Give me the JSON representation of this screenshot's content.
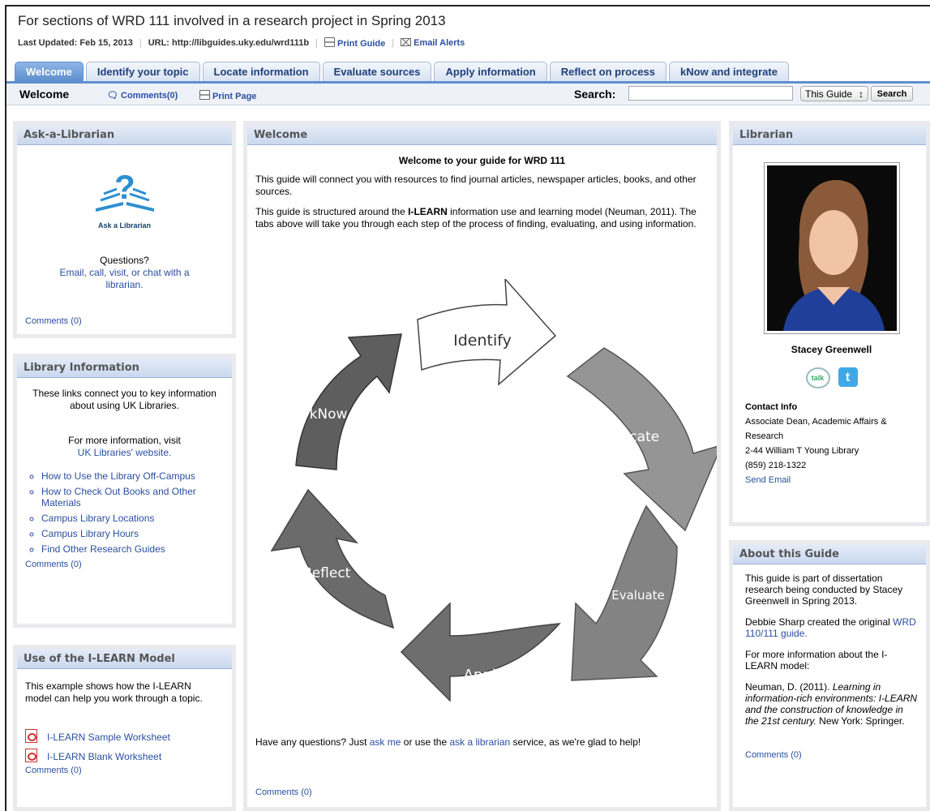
{
  "page": {
    "title": "For sections of WRD 111 involved in a research project in Spring 2013",
    "last_updated": "Last Updated: Feb 15, 2013",
    "url_label": "URL: http://libguides.uky.edu/wrd111b",
    "print_guide": "Print Guide",
    "email_alerts": "Email Alerts"
  },
  "tabs": [
    {
      "label": "Welcome",
      "active": true
    },
    {
      "label": "Identify your topic"
    },
    {
      "label": "Locate information"
    },
    {
      "label": "Evaluate sources"
    },
    {
      "label": "Apply information"
    },
    {
      "label": "Reflect on process"
    },
    {
      "label": "kNow and integrate"
    }
  ],
  "subbar": {
    "page_name": "Welcome",
    "comments": "Comments(0)",
    "print_page": "Print Page",
    "search_label": "Search:",
    "search_value": "",
    "scope": "This Guide",
    "search_button": "Search"
  },
  "ask": {
    "title": "Ask-a-Librarian",
    "logo_text": "Ask a Librarian",
    "questions": "Questions?",
    "link": "Email, call, visit, or chat with a librarian.",
    "comments": "Comments (0)"
  },
  "libinfo": {
    "title": "Library Information",
    "intro": "These links connect you to key information about using UK Libraries.",
    "more": "For more information, visit",
    "more_link": "UK Libraries' website.",
    "links": [
      "How to Use the Library Off-Campus",
      "How to Check Out Books and Other Materials",
      "Campus Library Locations",
      "Campus Library Hours",
      "Find Other Research Guides"
    ],
    "comments": "Comments (0)"
  },
  "model": {
    "title": "Use of the I-LEARN Model",
    "text": "This example shows how the I-LEARN model can help you work through a topic.",
    "files": [
      "I-LEARN Sample Worksheet",
      "I-LEARN Blank Worksheet"
    ],
    "comments": "Comments (0)"
  },
  "welcome": {
    "title": "Welcome",
    "heading": "Welcome to your guide for WRD 111",
    "p1": "This guide will connect you with resources to find journal articles, newspaper articles, books, and other sources.",
    "p2_a": "This guide is structured around the ",
    "p2_b": "I-LEARN",
    "p2_c": " information use and learning model (Neuman, 2011).  The tabs above will take you through each step of the process of finding, evaluating, and using information.",
    "cycle": [
      "Identify",
      "Locate",
      "Evaluate",
      "Apply",
      "Reflect",
      "kNow"
    ],
    "closing_a": "Have any questions?  Just ",
    "ask_me": "ask me",
    "closing_b": " or use the ",
    "ask_lib": "ask a librarian",
    "closing_c": " service, as we're glad to help!",
    "comments": "Comments (0)"
  },
  "librarian": {
    "title": "Librarian",
    "name": "Stacey Greenwell",
    "talk_badge": "talk",
    "contact_label": "Contact Info",
    "role": "Associate Dean, Academic Affairs & Research",
    "address": "2-44 William T Young Library",
    "phone": "(859) 218-1322",
    "send_email": "Send Email"
  },
  "about": {
    "title": "About this Guide",
    "p1": "This guide is part of dissertation research being conducted by Stacey Greenwell in Spring 2013.",
    "p2_a": "Debbie Sharp created the original ",
    "p2_link": "WRD 110/111 guide.",
    "p3": "For more information about the I-LEARN model:",
    "ref_a": "Neuman, D. (2011). ",
    "ref_title": "Learning in information-rich environments: I-LEARN and the construction of knowledge in the 21st century.",
    "ref_b": " New York: Springer.",
    "comments": "Comments (0)"
  },
  "colors": {
    "tab_active": "#5f8fcf",
    "link": "#2a4fa0",
    "arrow_dark": "#666666",
    "arrow_mid": "#959595"
  }
}
